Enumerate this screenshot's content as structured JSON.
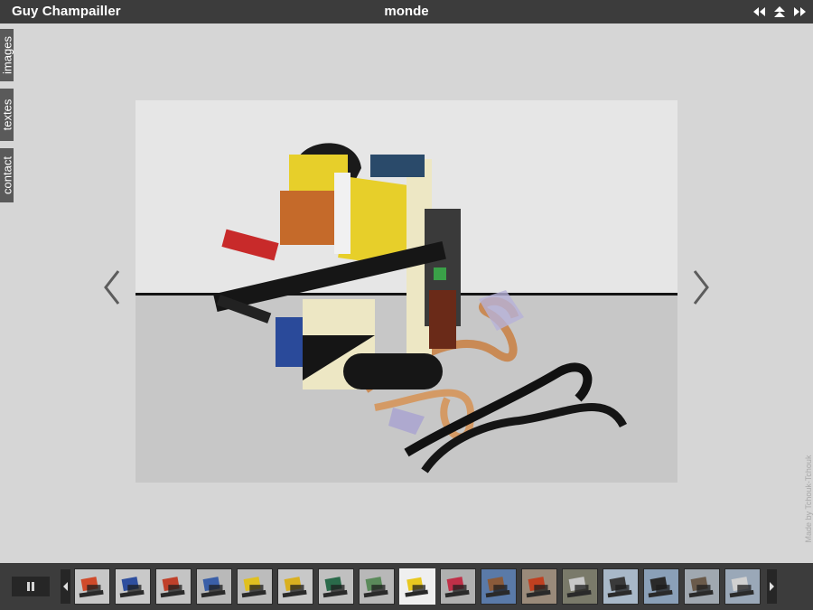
{
  "header": {
    "site_title": "Guy Champailler",
    "gallery_title": "monde"
  },
  "header_nav": [
    {
      "icon": "rewind-icon"
    },
    {
      "icon": "up-icon"
    },
    {
      "icon": "fast-forward-icon"
    }
  ],
  "side_tabs": [
    {
      "label": "images"
    },
    {
      "label": "textes"
    },
    {
      "label": "contact"
    }
  ],
  "viewer": {
    "prev_icon": "chevron-left-icon",
    "next_icon": "chevron-right-icon"
  },
  "credit": "Made by Tchouk-Tchouk",
  "filmstrip": {
    "active_index": 8,
    "thumbnails": [
      {
        "bg": "#c7c7c7",
        "accent": "#d04a2a"
      },
      {
        "bg": "#c9c9c9",
        "accent": "#2f4f9e"
      },
      {
        "bg": "#c4c4c4",
        "accent": "#c0402a"
      },
      {
        "bg": "#b9b9b9",
        "accent": "#3a5fa8"
      },
      {
        "bg": "#bcbcbc",
        "accent": "#e0c020"
      },
      {
        "bg": "#c8c8c8",
        "accent": "#d9b020"
      },
      {
        "bg": "#c0c0c0",
        "accent": "#2a6a4a"
      },
      {
        "bg": "#b8b8b8",
        "accent": "#5a8a5a"
      },
      {
        "bg": "#efefef",
        "accent": "#e8c820"
      },
      {
        "bg": "#b0b0b0",
        "accent": "#c03048"
      },
      {
        "bg": "#5a7aa8",
        "accent": "#8a5a3a"
      },
      {
        "bg": "#9a8a7a",
        "accent": "#c04020"
      },
      {
        "bg": "#7a7a6a",
        "accent": "#c8c8c8"
      },
      {
        "bg": "#a8b8c8",
        "accent": "#3a3a3a"
      },
      {
        "bg": "#8aa0b8",
        "accent": "#2a2a2a"
      },
      {
        "bg": "#a0a8b0",
        "accent": "#6a5a4a"
      },
      {
        "bg": "#9aa8b8",
        "accent": "#d0d0d0"
      }
    ]
  }
}
